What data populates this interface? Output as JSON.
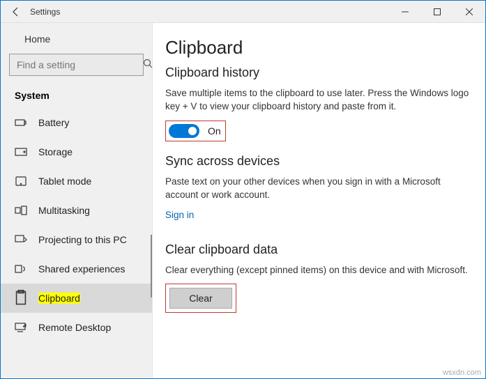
{
  "window": {
    "title": "Settings"
  },
  "sidebar": {
    "home": "Home",
    "search_placeholder": "Find a setting",
    "group": "System",
    "items": [
      {
        "label": "Battery"
      },
      {
        "label": "Storage"
      },
      {
        "label": "Tablet mode"
      },
      {
        "label": "Multitasking"
      },
      {
        "label": "Projecting to this PC"
      },
      {
        "label": "Shared experiences"
      },
      {
        "label": "Clipboard"
      },
      {
        "label": "Remote Desktop"
      }
    ]
  },
  "page": {
    "title": "Clipboard",
    "history": {
      "heading": "Clipboard history",
      "desc": "Save multiple items to the clipboard to use later. Press the Windows logo key + V to view your clipboard history and paste from it.",
      "toggle_state": "On"
    },
    "sync": {
      "heading": "Sync across devices",
      "desc": "Paste text on your other devices when you sign in with a Microsoft account or work account.",
      "link": "Sign in"
    },
    "clear": {
      "heading": "Clear clipboard data",
      "desc": "Clear everything (except pinned items) on this device and with Microsoft.",
      "button": "Clear"
    }
  },
  "attribution": "wsxdn.com"
}
